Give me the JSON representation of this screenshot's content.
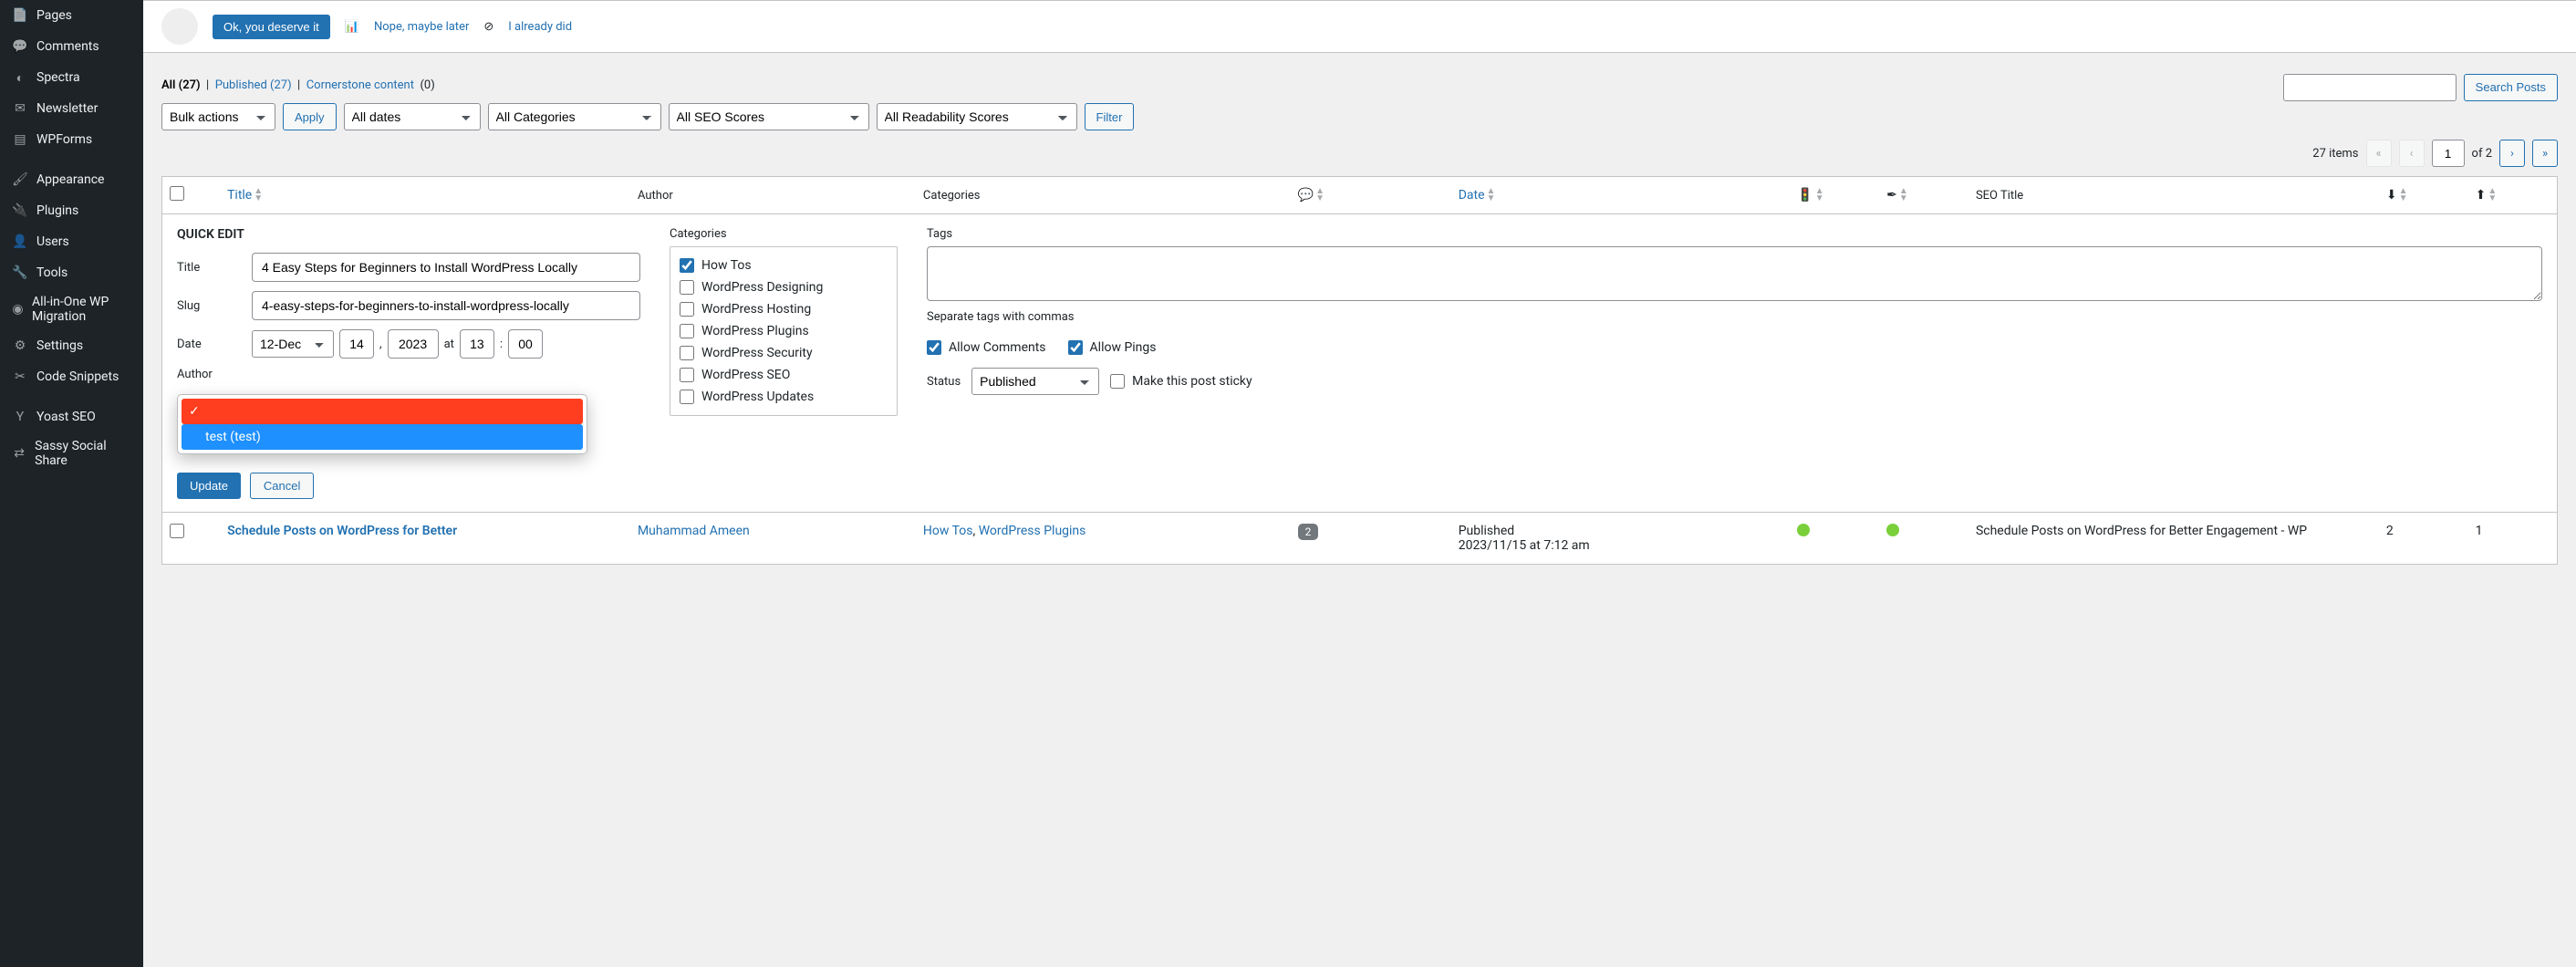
{
  "sidebar": {
    "items": [
      {
        "label": "Pages",
        "icon": "page-icon"
      },
      {
        "label": "Comments",
        "icon": "comment-icon"
      },
      {
        "label": "Spectra",
        "icon": "spectra-icon"
      },
      {
        "label": "Newsletter",
        "icon": "newsletter-icon"
      },
      {
        "label": "WPForms",
        "icon": "wpforms-icon"
      },
      {
        "label": "Appearance",
        "icon": "appearance-icon"
      },
      {
        "label": "Plugins",
        "icon": "plugin-icon"
      },
      {
        "label": "Users",
        "icon": "users-icon"
      },
      {
        "label": "Tools",
        "icon": "tools-icon"
      },
      {
        "label": "All-in-One WP Migration",
        "icon": "migration-icon"
      },
      {
        "label": "Settings",
        "icon": "settings-icon"
      },
      {
        "label": "Code Snippets",
        "icon": "code-icon"
      },
      {
        "label": "Yoast SEO",
        "icon": "yoast-icon"
      },
      {
        "label": "Sassy Social Share",
        "icon": "share-icon"
      }
    ]
  },
  "notice": {
    "ok_button": "Ok, you deserve it",
    "nope_link": "Nope, maybe later",
    "already_link": "I already did"
  },
  "filters_sub": {
    "all": "All",
    "all_count": "(27)",
    "published": "Published",
    "published_count": "(27)",
    "cornerstone": "Cornerstone content",
    "cornerstone_count": "(0)"
  },
  "toolbar": {
    "bulk_actions": "Bulk actions",
    "apply": "Apply",
    "all_dates": "All dates",
    "all_categories": "All Categories",
    "all_seo": "All SEO Scores",
    "all_readability": "All Readability Scores",
    "filter": "Filter",
    "search_posts": "Search Posts"
  },
  "pagination": {
    "items_text": "27 items",
    "page": "1",
    "of_text": "of 2"
  },
  "columns": {
    "title": "Title",
    "author": "Author",
    "categories": "Categories",
    "date": "Date",
    "seo_title": "SEO Title"
  },
  "quickedit": {
    "heading": "QUICK EDIT",
    "labels": {
      "title": "Title",
      "slug": "Slug",
      "date": "Date",
      "author": "Author",
      "at": "at",
      "comma": ",",
      "colon": ":"
    },
    "values": {
      "title": "4 Easy Steps for Beginners to Install WordPress Locally",
      "slug": "4-easy-steps-for-beginners-to-install-wordpress-locally",
      "month": "12-Dec",
      "day": "14",
      "year": "2023",
      "hour": "13",
      "minute": "00"
    },
    "author_options": {
      "selected_redacted": "",
      "second": "test (test)"
    },
    "categories_label": "Categories",
    "categories": [
      {
        "label": "How Tos",
        "checked": true
      },
      {
        "label": "WordPress Designing",
        "checked": false
      },
      {
        "label": "WordPress Hosting",
        "checked": false
      },
      {
        "label": "WordPress Plugins",
        "checked": false
      },
      {
        "label": "WordPress Security",
        "checked": false
      },
      {
        "label": "WordPress SEO",
        "checked": false
      },
      {
        "label": "WordPress Updates",
        "checked": false
      }
    ],
    "tags_label": "Tags",
    "tags_hint": "Separate tags with commas",
    "allow_comments": "Allow Comments",
    "allow_pings": "Allow Pings",
    "status_label": "Status",
    "status_value": "Published",
    "sticky_label": "Make this post sticky",
    "update": "Update",
    "cancel": "Cancel"
  },
  "row": {
    "title": "Schedule Posts on WordPress for Better",
    "author": "Muhammad Ameen",
    "categories_1": "How Tos",
    "categories_2": "WordPress Plugins",
    "comment_count": "2",
    "status": "Published",
    "date": "2023/11/15 at 7:12 am",
    "seo_title": "Schedule Posts on WordPress for Better Engagement - WP",
    "incoming": "2",
    "outgoing": "1"
  }
}
